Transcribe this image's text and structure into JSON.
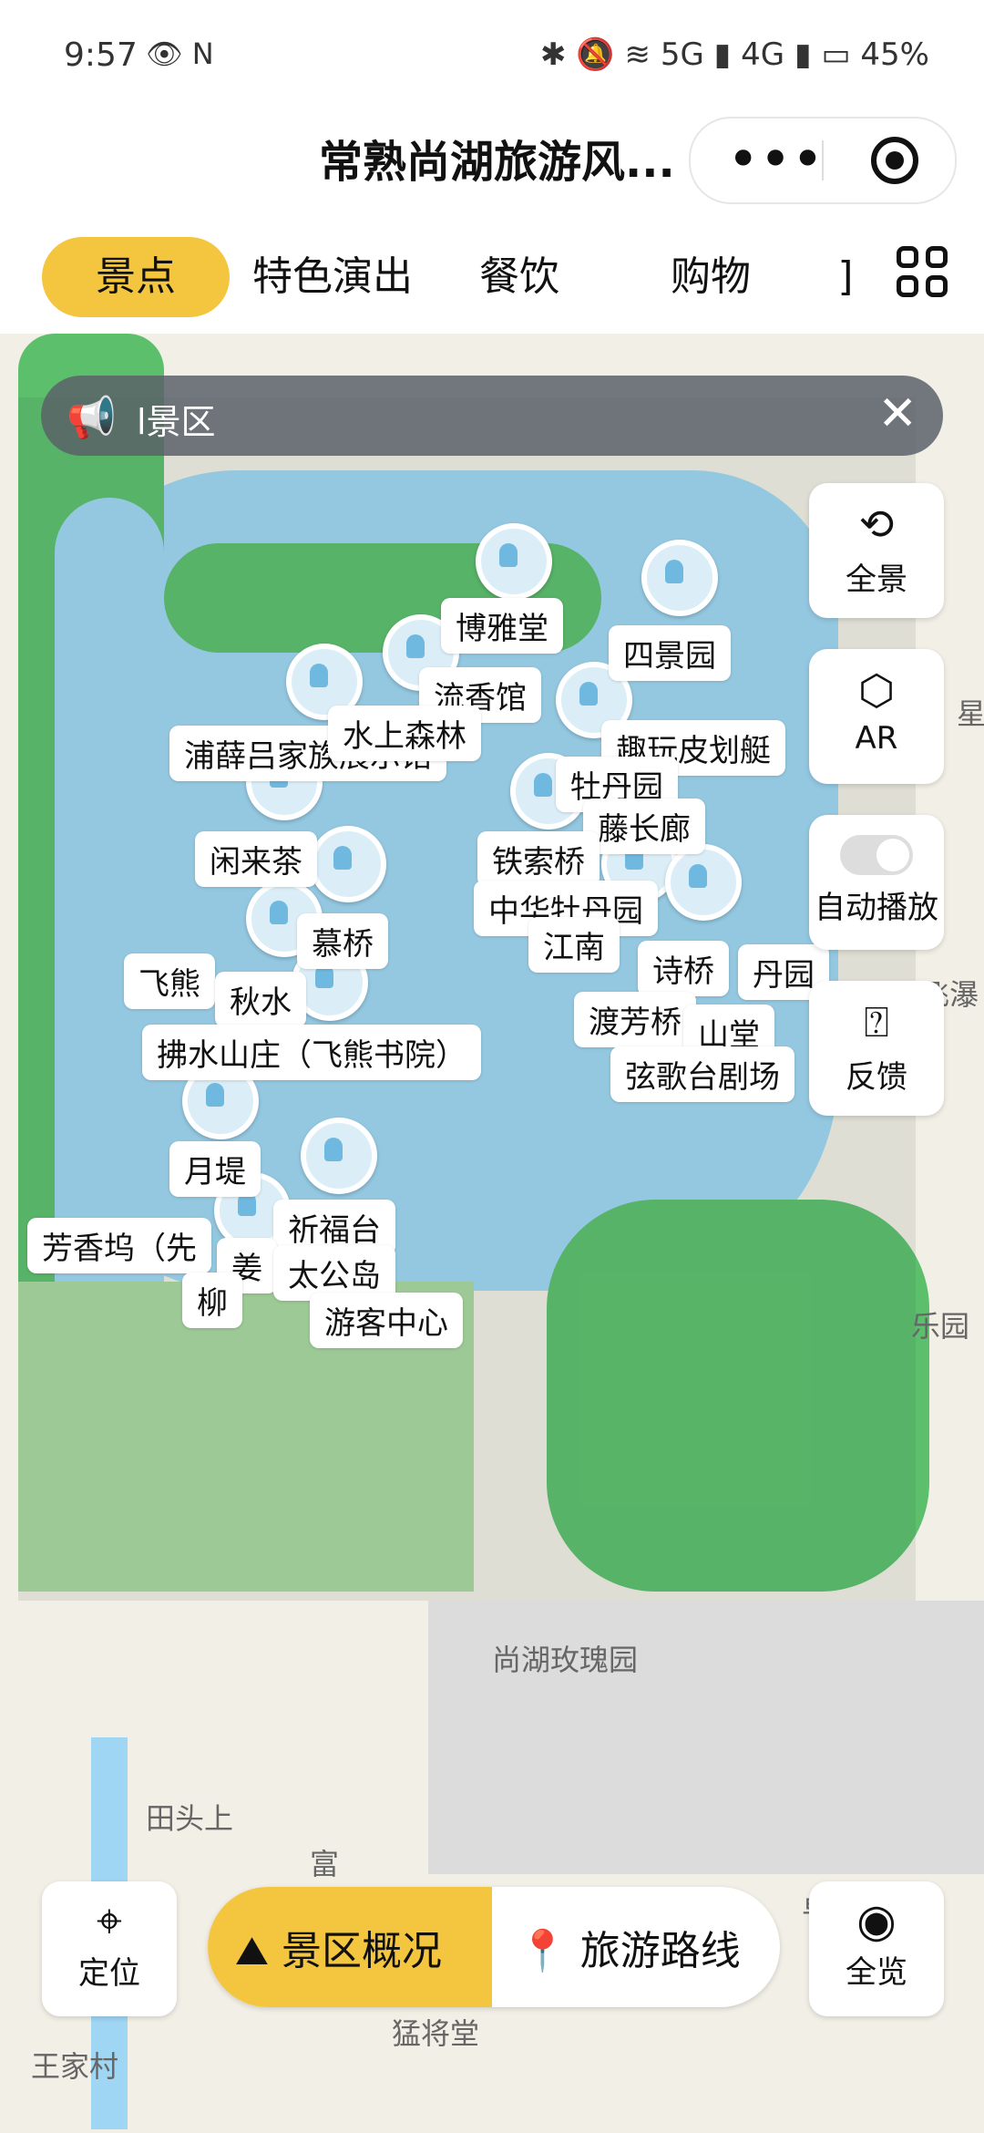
{
  "status_bar": {
    "time": "9:57",
    "battery": "45%",
    "net_5g": "5G",
    "net_4g": "4G"
  },
  "title_bar": {
    "title": "常熟尚湖旅游风...",
    "more_label": "•••"
  },
  "tabs": [
    {
      "label": "景点",
      "active": true
    },
    {
      "label": "特色演出",
      "active": false
    },
    {
      "label": "餐饮",
      "active": false
    },
    {
      "label": "购物",
      "active": false
    },
    {
      "label": "]",
      "active": false
    }
  ],
  "banner": {
    "text": "l景区"
  },
  "poi_labels": [
    "博雅堂",
    "四景园",
    "流香馆",
    "浦薛吕家族展示馆",
    "水上森林",
    "趣玩皮划艇",
    "牡丹园",
    "藤长廊",
    "闲来茶",
    "铁索桥",
    "中华牡丹园",
    "江南",
    "慕桥",
    "飞熊",
    "秋水",
    "诗桥",
    "丹园",
    "渡芳桥",
    "山堂",
    "拂水山庄（飞熊书院）",
    "弦歌台剧场",
    "月堤",
    "芳香坞（先",
    "祈福台",
    "姜",
    "太公岛",
    "柳",
    "游客中心"
  ],
  "map_text": [
    "尚湖玫瑰园",
    "田头上",
    "富",
    "王家村",
    "猛将堂",
    "乐园",
    "星",
    "飞瀑",
    "卓"
  ],
  "side_tools": [
    {
      "label": "全景",
      "icon": "360-icon"
    },
    {
      "label": "AR",
      "icon": "ar-icon"
    },
    {
      "label": "自动播放",
      "icon": "toggle-icon"
    },
    {
      "label": "反馈",
      "icon": "feedback-icon"
    }
  ],
  "bottom": {
    "locate": "定位",
    "overview": "景区概况",
    "route": "旅游路线",
    "all": "全览"
  },
  "colors": {
    "accent": "#f4c640",
    "water": "#9fd6f4",
    "green": "#5bbf6c"
  }
}
